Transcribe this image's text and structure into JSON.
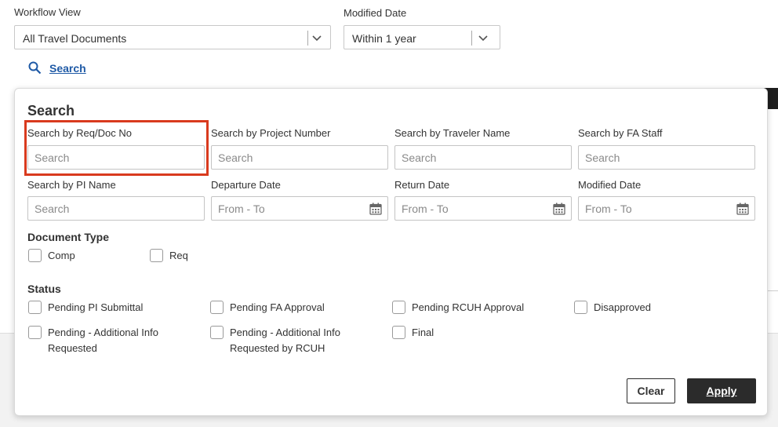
{
  "filters": {
    "workflow_view": {
      "label": "Workflow View",
      "value": "All Travel Documents"
    },
    "modified_date": {
      "label": "Modified Date",
      "value": "Within 1 year"
    },
    "search_link": "Search"
  },
  "search_panel": {
    "title": "Search",
    "fields": {
      "req_doc": {
        "label": "Search by Req/Doc No",
        "placeholder": "Search"
      },
      "project": {
        "label": "Search by Project Number",
        "placeholder": "Search"
      },
      "traveler": {
        "label": "Search by Traveler Name",
        "placeholder": "Search"
      },
      "fa_staff": {
        "label": "Search by FA Staff",
        "placeholder": "Search"
      },
      "pi_name": {
        "label": "Search by PI Name",
        "placeholder": "Search"
      },
      "departure": {
        "label": "Departure Date",
        "placeholder": "From - To"
      },
      "return": {
        "label": "Return Date",
        "placeholder": "From - To"
      },
      "modified": {
        "label": "Modified Date",
        "placeholder": "From - To"
      }
    },
    "document_type": {
      "title": "Document Type",
      "options": [
        "Comp",
        "Req"
      ]
    },
    "status": {
      "title": "Status",
      "options": [
        "Pending PI Submittal",
        "Pending FA Approval",
        "Pending RCUH Approval",
        "Disapproved",
        "Pending - Additional Info Requested",
        "Pending - Additional Info Requested by RCUH",
        "Final"
      ]
    },
    "buttons": {
      "clear": "Clear",
      "apply": "Apply"
    }
  },
  "colors": {
    "link": "#1f5aa6",
    "highlight": "#d93a1e",
    "apply_bg": "#2b2b2b"
  }
}
